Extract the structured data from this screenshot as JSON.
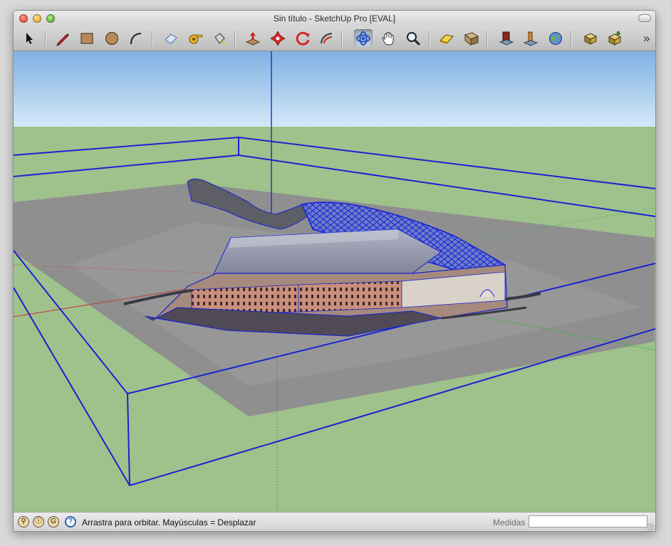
{
  "window": {
    "title": "Sin título - SketchUp Pro [EVAL]"
  },
  "toolbar": {
    "tools": [
      {
        "id": "select",
        "icon": "select-arrow-icon"
      },
      {
        "id": "pencil",
        "icon": "pencil-icon"
      },
      {
        "id": "rectangle",
        "icon": "rectangle-icon"
      },
      {
        "id": "circle",
        "icon": "circle-icon"
      },
      {
        "id": "arc",
        "icon": "arc-icon"
      },
      {
        "id": "eraser",
        "icon": "eraser-icon"
      },
      {
        "id": "tape",
        "icon": "tape-measure-icon"
      },
      {
        "id": "paint",
        "icon": "paint-bucket-icon"
      },
      {
        "id": "pushpull",
        "icon": "push-pull-icon"
      },
      {
        "id": "move",
        "icon": "move-icon"
      },
      {
        "id": "rotate",
        "icon": "rotate-icon"
      },
      {
        "id": "followme",
        "icon": "follow-me-icon"
      },
      {
        "id": "orbit",
        "icon": "orbit-icon",
        "selected": true
      },
      {
        "id": "pan",
        "icon": "pan-hand-icon"
      },
      {
        "id": "zoom",
        "icon": "zoom-icon"
      },
      {
        "id": "scene1",
        "icon": "scene-icon"
      },
      {
        "id": "scene2",
        "icon": "section-icon"
      },
      {
        "id": "components",
        "icon": "components-icon"
      },
      {
        "id": "materials",
        "icon": "materials-icon"
      },
      {
        "id": "earth",
        "icon": "google-earth-icon"
      },
      {
        "id": "extension1",
        "icon": "share-model-icon"
      },
      {
        "id": "extension2",
        "icon": "get-models-icon"
      }
    ],
    "more_icon": "»"
  },
  "status": {
    "hint": "Arrastra para orbitar. Mayúsculas = Desplazar",
    "measure_label": "Medidas",
    "measure_value": ""
  }
}
